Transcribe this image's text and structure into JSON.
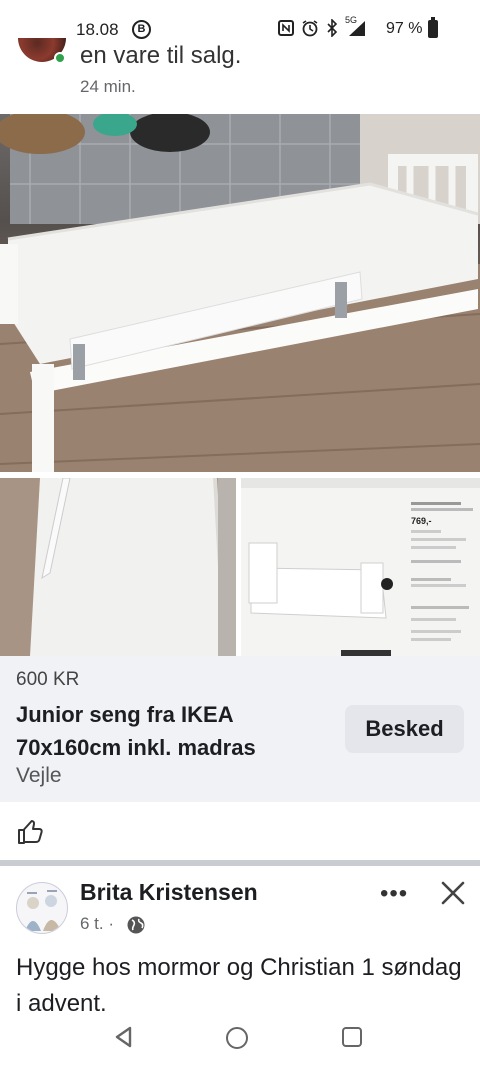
{
  "status_bar": {
    "time": "18.08",
    "b_badge": "B",
    "signal_label": "5G",
    "battery": "97 %"
  },
  "post": {
    "text_top": "en vare til salg.",
    "time": "24 min."
  },
  "listing": {
    "price": "600 KR",
    "title": "Junior seng fra IKEA 70x160cm inkl. madras",
    "location": "Vejle",
    "message_button": "Besked",
    "screenshot_price": "769,-"
  },
  "next_post": {
    "author": "Brita Kristensen",
    "time": "6 t. ·",
    "more": "•••",
    "text": "Hygge hos mormor og Christian 1 søndag i advent."
  },
  "colors": {
    "card_bg": "#f0f2f5",
    "button_bg": "#e4e6eb",
    "online_dot": "#31a24c",
    "divider": "#c9ccd1"
  },
  "icons": [
    "nfc-icon",
    "alarm-icon",
    "bluetooth-icon",
    "signal-icon",
    "battery-icon",
    "like-icon",
    "globe-icon",
    "more-icon",
    "close-icon",
    "back-icon",
    "home-icon",
    "recent-apps-icon"
  ]
}
